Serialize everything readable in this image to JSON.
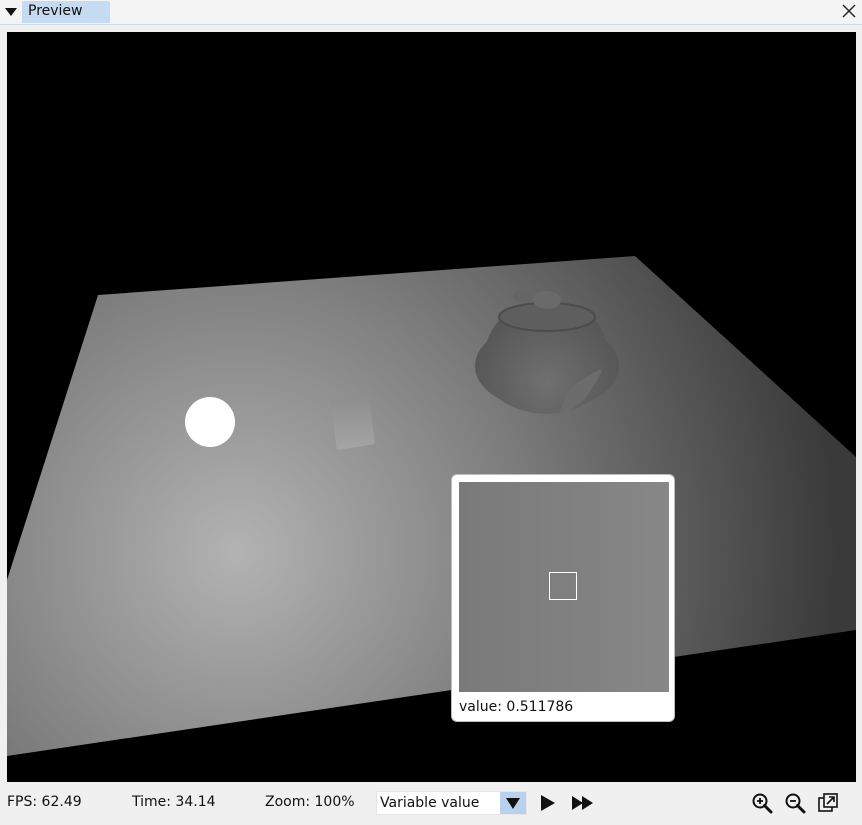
{
  "window": {
    "tab_title": "Preview",
    "icons": {
      "menu": "menu-triangle-icon",
      "close": "close-icon"
    }
  },
  "magnifier": {
    "value_text": "value: 0.511786"
  },
  "status": {
    "fps": "FPS: 62.49",
    "time": "Time: 34.14",
    "zoom": "Zoom: 100%",
    "mode_select": {
      "value": "Variable value",
      "options": [
        "Variable value"
      ]
    },
    "controls": [
      "play-icon",
      "fast-forward-icon",
      "zoom-in-icon",
      "zoom-out-icon",
      "popout-icon"
    ]
  },
  "colors": {
    "tab_active": "#c6daf2",
    "dropdown_button": "#b9d1ee",
    "background": "#f0f0f0"
  }
}
